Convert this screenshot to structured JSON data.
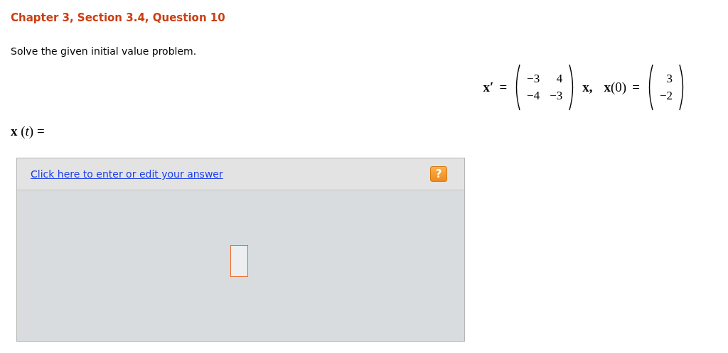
{
  "heading": "Chapter 3, Section 3.4, Question 10",
  "instruction": "Solve the given initial value problem.",
  "equation": {
    "lhs": "x′",
    "equals": "=",
    "matrix": [
      [
        "−3",
        "4"
      ],
      [
        "−4",
        "−3"
      ]
    ],
    "multiplier": "x,",
    "initial_lhs": "**x**(0)",
    "initial_equals": "=",
    "initial_vector": [
      "3",
      "−2"
    ]
  },
  "answer_label": "**x** (*t*) =",
  "answer_panel": {
    "link": "Click here to enter or edit your answer",
    "help_button": "?"
  }
}
